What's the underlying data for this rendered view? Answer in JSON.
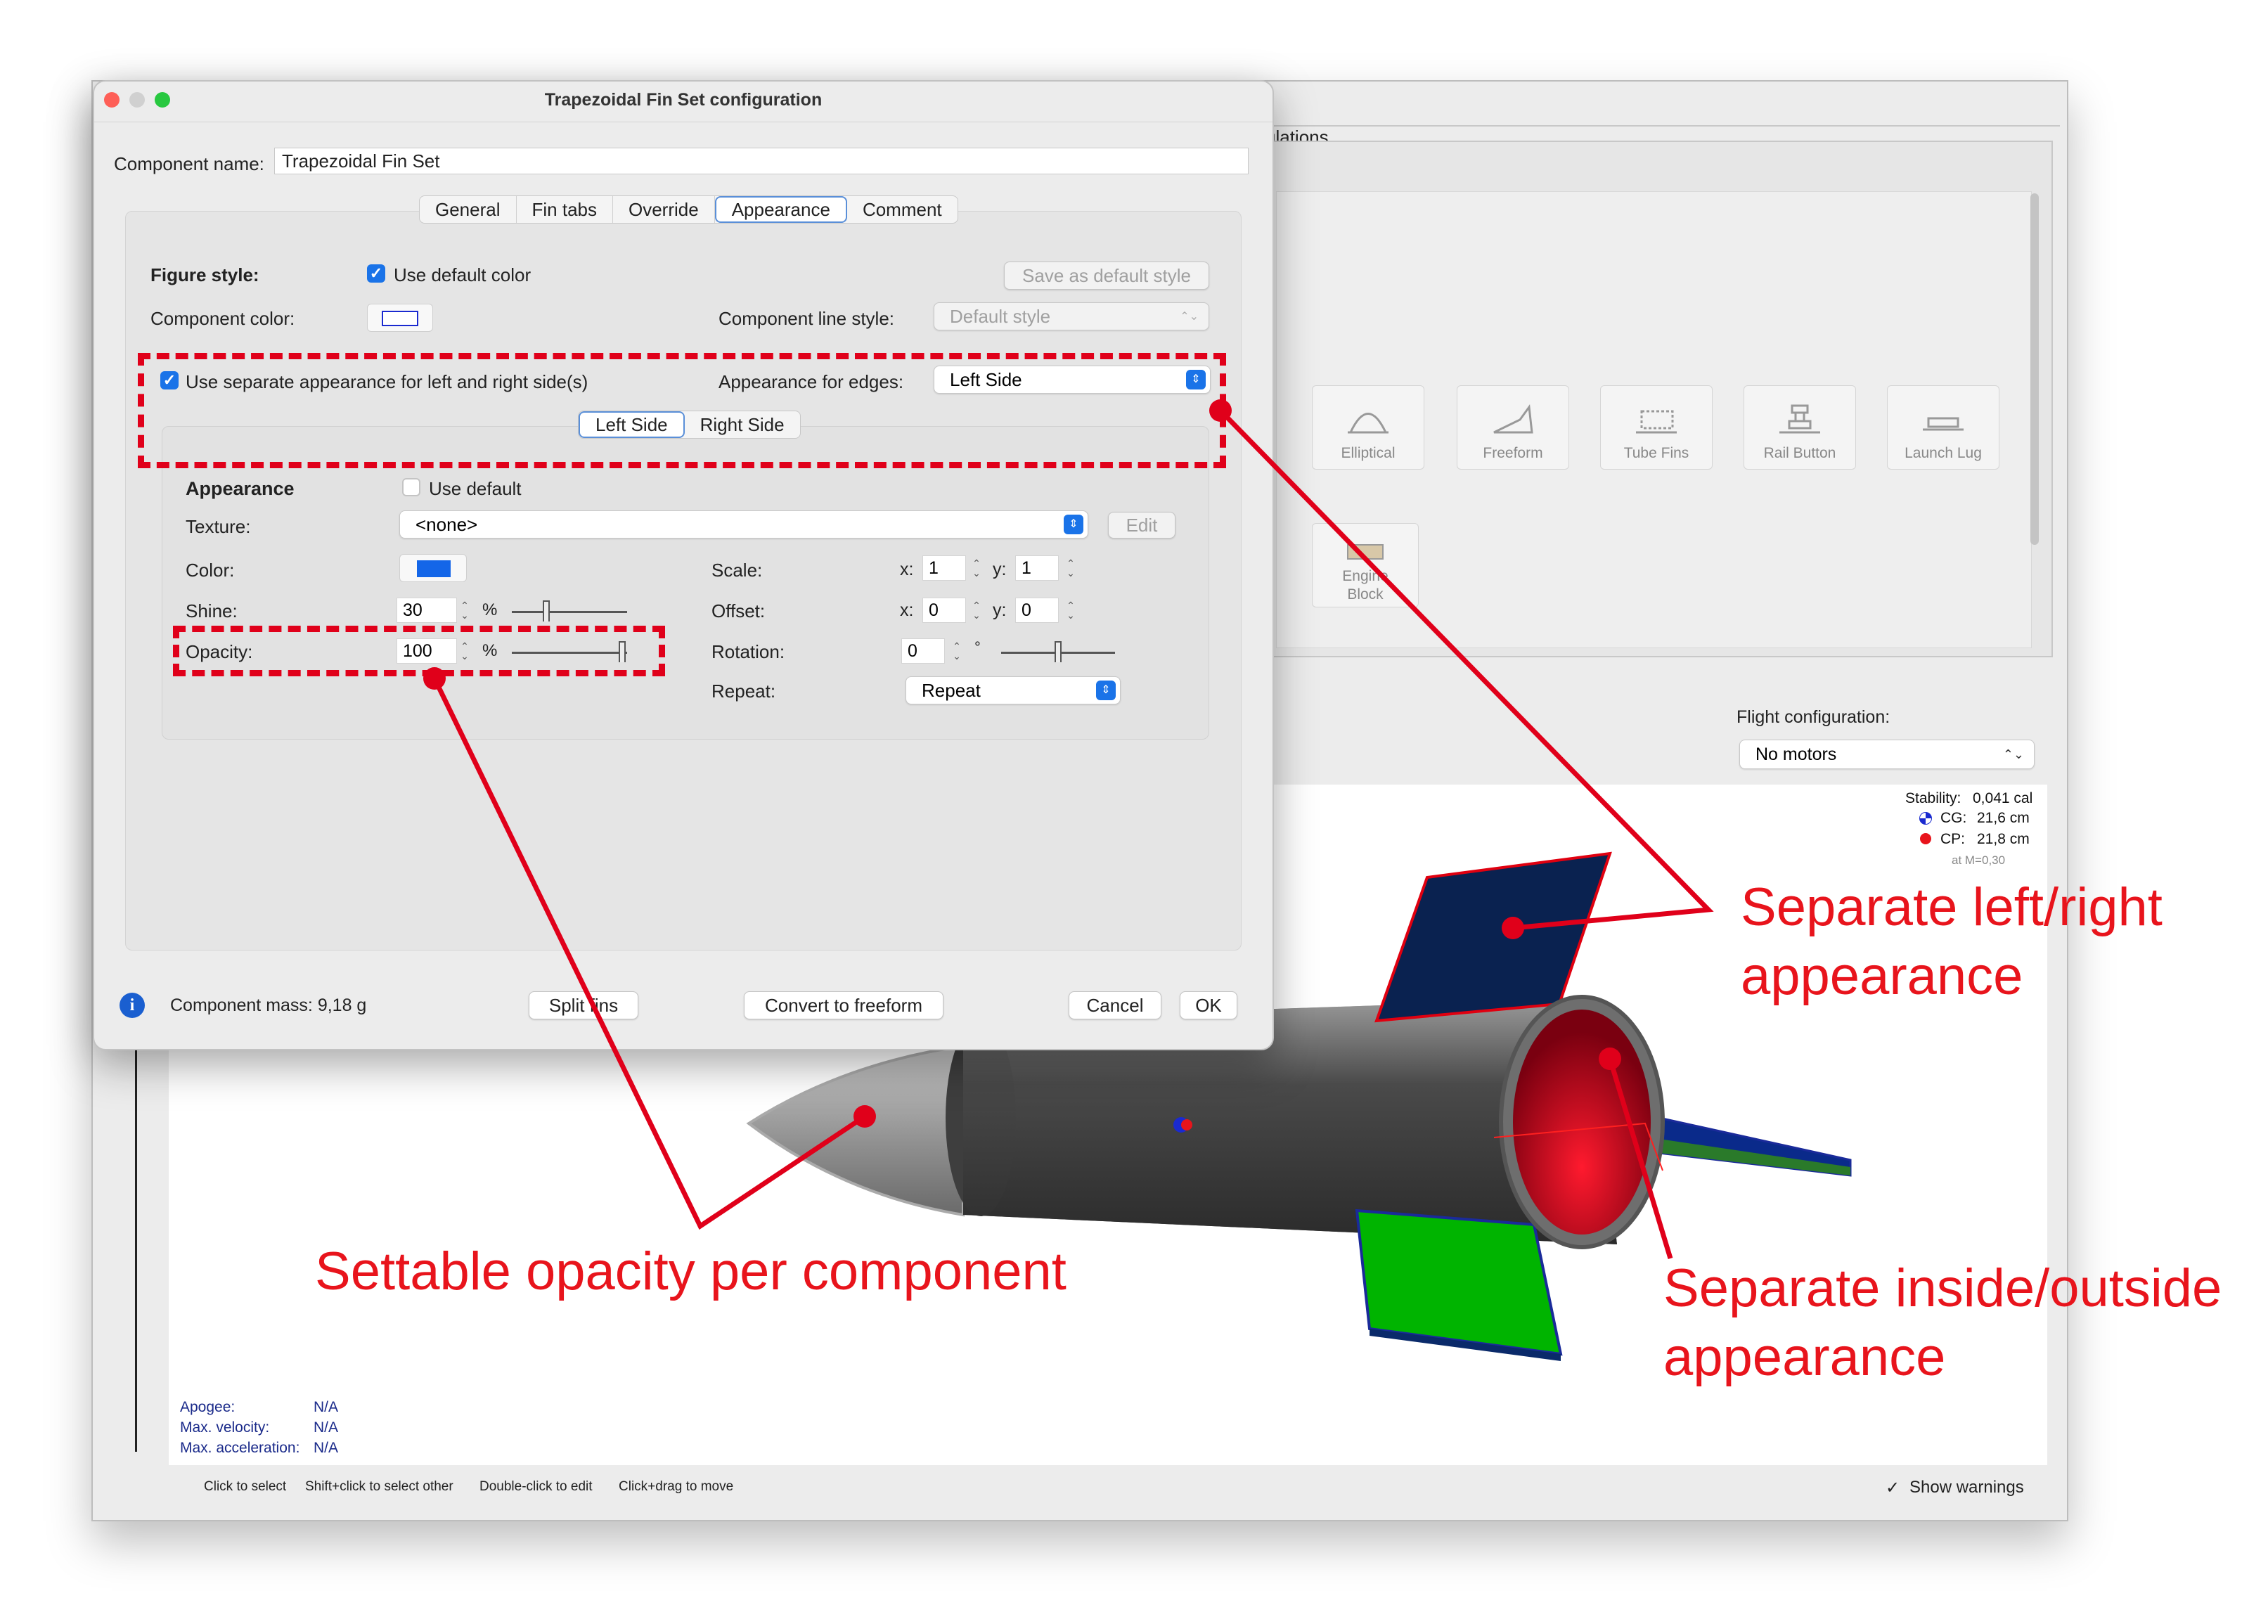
{
  "background_window": {
    "simulations_tab": "ulations",
    "palette": [
      {
        "label": "Elliptical",
        "icon": "elliptical-fin-icon"
      },
      {
        "label": "Freeform",
        "icon": "freeform-fin-icon"
      },
      {
        "label": "Tube Fins",
        "icon": "tube-fins-icon"
      },
      {
        "label": "Rail Button",
        "icon": "rail-button-icon"
      },
      {
        "label": "Launch Lug",
        "icon": "launch-lug-icon"
      }
    ],
    "engine_block_label": "Engine Block",
    "flight_config_label": "Flight configuration:",
    "flight_config_value": "No motors",
    "stability": {
      "stability_label": "Stability:",
      "stability_value": "0,041 cal",
      "cg_label": "CG:",
      "cg_value": "21,6 cm",
      "cp_label": "CP:",
      "cp_value": "21,8 cm",
      "mach": "at M=0,30"
    },
    "flight_data": [
      {
        "label": "Apogee:",
        "value": "N/A"
      },
      {
        "label": "Max. velocity:",
        "value": "N/A"
      },
      {
        "label": "Max. acceleration:",
        "value": "N/A"
      }
    ],
    "status_hints": [
      "Click to select",
      "Shift+click to select other",
      "Double-click to edit",
      "Click+drag to move"
    ],
    "show_warnings": "Show warnings"
  },
  "dialog": {
    "title": "Trapezoidal Fin Set configuration",
    "component_name_label": "Component name:",
    "component_name_value": "Trapezoidal Fin Set",
    "tabs": [
      "General",
      "Fin tabs",
      "Override",
      "Appearance",
      "Comment"
    ],
    "selected_tab": "Appearance",
    "figure_style_label": "Figure style:",
    "use_default_color": "Use default color",
    "save_default_style": "Save as default style",
    "component_color_label": "Component color:",
    "component_line_style_label": "Component line style:",
    "line_style_value": "Default style",
    "separate_appearance": "Use separate appearance for left and right side(s)",
    "appearance_edges_label": "Appearance for edges:",
    "appearance_edges_value": "Left Side",
    "side_tabs": [
      "Left Side",
      "Right Side"
    ],
    "appearance_heading": "Appearance",
    "use_default": "Use default",
    "texture_label": "Texture:",
    "texture_value": "<none>",
    "edit_button": "Edit",
    "color_label": "Color:",
    "color_swatch": "#1466e8",
    "shine_label": "Shine:",
    "shine_value": "30",
    "percent": "%",
    "opacity_label": "Opacity:",
    "opacity_value": "100",
    "scale_label": "Scale:",
    "offset_label": "Offset:",
    "rotation_label": "Rotation:",
    "repeat_label": "Repeat:",
    "repeat_value": "Repeat",
    "x_label": "x:",
    "y_label": "y:",
    "scale_x": "1",
    "scale_y": "1",
    "offset_x": "0",
    "offset_y": "0",
    "rotation_value": "0",
    "degree": "°",
    "mass_label": "Component mass: 9,18 g",
    "split_fins": "Split fins",
    "convert_freeform": "Convert to freeform",
    "cancel": "Cancel",
    "ok": "OK"
  },
  "annotations": {
    "left_right": [
      "Separate left/right",
      "appearance"
    ],
    "opacity": "Settable opacity per component",
    "inside_outside": [
      "Separate inside/outside",
      "appearance"
    ],
    "color": "#e8141c"
  }
}
